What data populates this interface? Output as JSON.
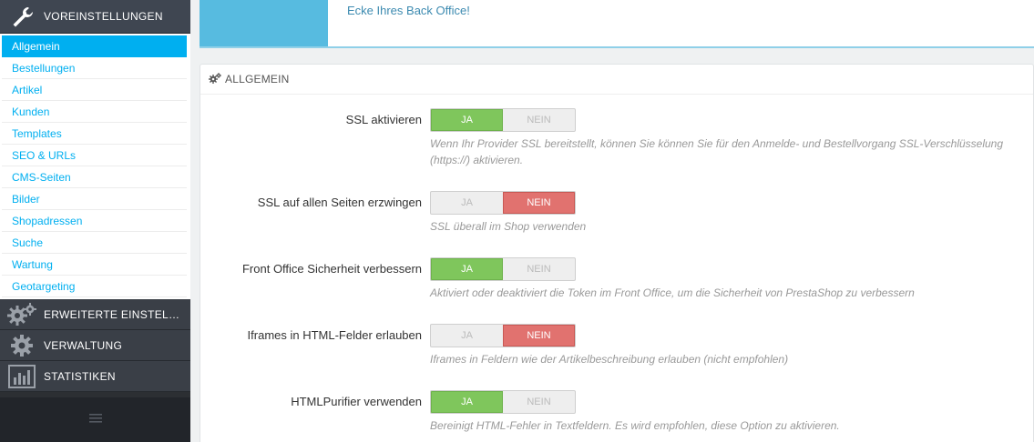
{
  "sidebar": {
    "active_section": {
      "label": "VOREINSTELLUNGEN",
      "icon": "wrench-icon"
    },
    "submenu": [
      {
        "label": "Allgemein",
        "selected": true
      },
      {
        "label": "Bestellungen"
      },
      {
        "label": "Artikel"
      },
      {
        "label": "Kunden"
      },
      {
        "label": "Templates"
      },
      {
        "label": "SEO & URLs"
      },
      {
        "label": "CMS-Seiten"
      },
      {
        "label": "Bilder"
      },
      {
        "label": "Shopadressen"
      },
      {
        "label": "Suche"
      },
      {
        "label": "Wartung"
      },
      {
        "label": "Geotargeting"
      }
    ],
    "sections": [
      {
        "label": "ERWEITERTE EINSTELLUN...",
        "icon": "gears-icon"
      },
      {
        "label": "VERWALTUNG",
        "icon": "gear-icon"
      },
      {
        "label": "STATISTIKEN",
        "icon": "bar-chart-icon"
      }
    ],
    "collapse_icon": "hamburger-icon"
  },
  "top_panel": {
    "message": "Ecke Ihres Back Office!"
  },
  "panel": {
    "title": "ALLGEMEIN",
    "icon": "cogs-icon",
    "settings": [
      {
        "label": "SSL aktivieren",
        "yes": "JA",
        "no": "NEIN",
        "value": "yes",
        "help": "Wenn Ihr Provider SSL bereitstellt, können Sie können Sie für den Anmelde- und Bestellvorgang SSL-Verschlüsselung (https://) aktivieren."
      },
      {
        "label": "SSL auf allen Seiten erzwingen",
        "yes": "JA",
        "no": "NEIN",
        "value": "no",
        "help": "SSL überall im Shop verwenden"
      },
      {
        "label": "Front Office Sicherheit verbessern",
        "yes": "JA",
        "no": "NEIN",
        "value": "yes",
        "help": "Aktiviert oder deaktiviert die Token im Front Office, um die Sicherheit von PrestaShop zu verbessern"
      },
      {
        "label": "Iframes in HTML-Felder erlauben",
        "yes": "JA",
        "no": "NEIN",
        "value": "no",
        "help": "Iframes in Feldern wie der Artikelbeschreibung erlauben (nicht empfohlen)"
      },
      {
        "label": "HTMLPurifier verwenden",
        "yes": "JA",
        "no": "NEIN",
        "value": "yes",
        "help": "Bereinigt HTML-Fehler in Textfeldern. Es wird empfohlen, diese Option zu aktivieren."
      }
    ]
  },
  "colors": {
    "accent": "#00aff0",
    "yes_active": "#7fc65c",
    "no_active": "#e1726f",
    "sidebar_bg": "#2c2f33"
  }
}
